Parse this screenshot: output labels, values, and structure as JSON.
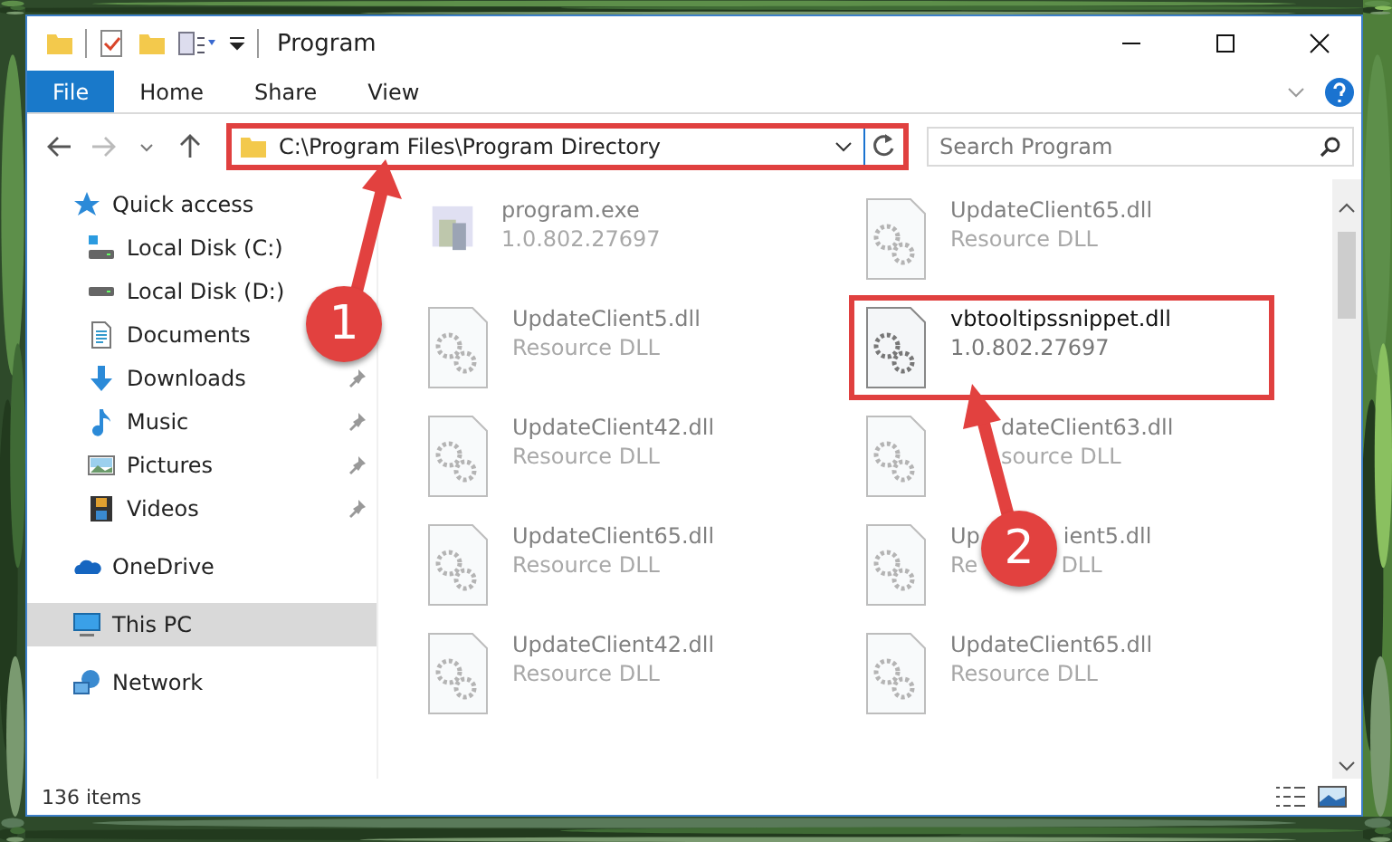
{
  "window": {
    "title": "Program"
  },
  "ribbon_tabs": [
    {
      "label": "File",
      "selected": true
    },
    {
      "label": "Home",
      "selected": false
    },
    {
      "label": "Share",
      "selected": false
    },
    {
      "label": "View",
      "selected": false
    }
  ],
  "address": {
    "path": "C:\\Program Files\\Program Directory",
    "highlighted": true
  },
  "search": {
    "placeholder": "Search Program"
  },
  "sidebar": {
    "items": [
      {
        "label": "Quick access",
        "kind": "star",
        "selected": false,
        "children": [
          {
            "label": "Local Disk (C:)",
            "kind": "windrive",
            "pinned": false,
            "selected": false
          },
          {
            "label": "Local Disk (D:)",
            "kind": "drive",
            "pinned": false,
            "selected": false
          },
          {
            "label": "Documents",
            "kind": "documents",
            "pinned": false,
            "selected": false
          },
          {
            "label": "Downloads",
            "kind": "downloads",
            "pinned": true,
            "selected": false
          },
          {
            "label": "Music",
            "kind": "music",
            "pinned": true,
            "selected": false
          },
          {
            "label": "Pictures",
            "kind": "pictures",
            "pinned": true,
            "selected": false
          },
          {
            "label": "Videos",
            "kind": "videos",
            "pinned": true,
            "selected": false
          }
        ]
      },
      {
        "label": "OneDrive",
        "kind": "cloud",
        "selected": false
      },
      {
        "label": "This PC",
        "kind": "pc",
        "selected": true
      },
      {
        "label": "Network",
        "kind": "network",
        "selected": false
      }
    ]
  },
  "files": [
    {
      "name_parts": [
        "program.exe"
      ],
      "detail_parts": [
        "1.0.802.27697"
      ],
      "kind": "exe",
      "blurred": true,
      "highlighted": false
    },
    {
      "name_parts": [
        "UpdateClient65.dll"
      ],
      "detail_parts": [
        "Resource DLL"
      ],
      "kind": "dll",
      "blurred": true,
      "highlighted": false
    },
    {
      "name_parts": [
        "UpdateClient5.dll"
      ],
      "detail_parts": [
        "Resource DLL"
      ],
      "kind": "dll",
      "blurred": true,
      "highlighted": false
    },
    {
      "name_parts": [
        "vbtooltipssnippet.dll"
      ],
      "detail_parts": [
        "1.0.802.27697"
      ],
      "kind": "dll",
      "blurred": false,
      "highlighted": true
    },
    {
      "name_parts": [
        "UpdateClient42.dll"
      ],
      "detail_parts": [
        "Resource DLL"
      ],
      "kind": "dll",
      "blurred": true,
      "highlighted": false
    },
    {
      "name_parts": [
        "dateClient63.dll"
      ],
      "detail_parts": [
        "source DLL"
      ],
      "kind": "dll",
      "blurred": true,
      "highlighted": false,
      "covered_start": true
    },
    {
      "name_parts": [
        "UpdateClient65.dll"
      ],
      "detail_parts": [
        "Resource DLL"
      ],
      "kind": "dll",
      "blurred": true,
      "highlighted": false
    },
    {
      "name_parts": [
        "Up",
        "ient5.dll"
      ],
      "detail_parts": [
        "Re",
        "DLL"
      ],
      "kind": "dll",
      "blurred": true,
      "highlighted": false,
      "covered_middle": true
    },
    {
      "name_parts": [
        "UpdateClient42.dll"
      ],
      "detail_parts": [
        "Resource DLL"
      ],
      "kind": "dll",
      "blurred": true,
      "highlighted": false
    },
    {
      "name_parts": [
        "UpdateClient65.dll"
      ],
      "detail_parts": [
        "Resource DLL"
      ],
      "kind": "dll",
      "blurred": true,
      "highlighted": false
    }
  ],
  "status_bar": {
    "items": "136 items"
  },
  "annotations": [
    {
      "label": "1"
    },
    {
      "label": "2"
    }
  ]
}
